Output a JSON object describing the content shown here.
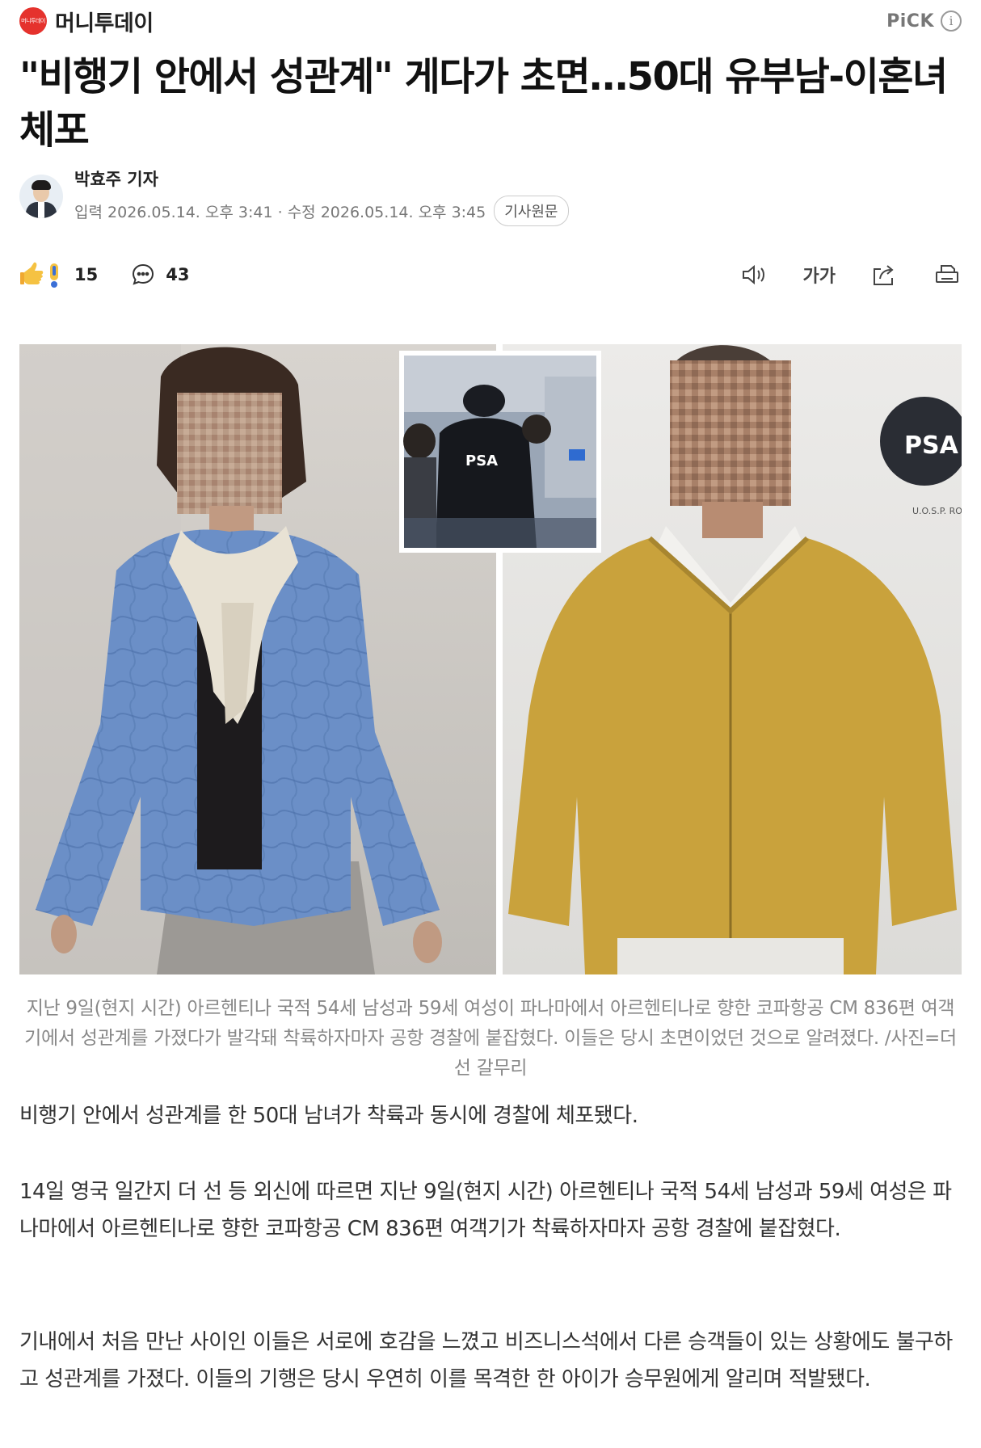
{
  "header": {
    "press_name": "머니투데이",
    "press_logo_text": "머니투데이",
    "pick_label": "PiCK",
    "info_icon": "info-icon"
  },
  "article": {
    "title": "\"비행기 안에서 성관계\" 게다가 초면…50대 유부남-이혼녀 체포",
    "reporter": "박효주 기자",
    "published_label": "입력",
    "published": "2026.05.14. 오후 3:41",
    "modified_label": "· 수정",
    "modified": "2026.05.14. 오후 3:45",
    "origin_button": "기사원문"
  },
  "actions": {
    "reaction_count": "15",
    "comment_count": "43",
    "font_label": "가가",
    "icons": [
      "reaction-icon",
      "comment-icon",
      "audio-icon",
      "font-size-icon",
      "share-icon",
      "print-icon"
    ]
  },
  "photo": {
    "inset_jacket_text": "PSA",
    "badge_text": "PSA",
    "wall_text": "U.O.S.P. RO"
  },
  "caption": "지난 9일(현지 시간) 아르헨티나 국적 54세 남성과 59세 여성이 파나마에서 아르헨티나로 향한 코파항공 CM 836편 여객기에서 성관계를 가졌다가 발각돼 착륙하자마자 공항 경찰에 붙잡혔다. 이들은 당시 초면이었던 것으로 알려졌다. /사진=더 선 갈무리",
  "body": [
    "비행기 안에서 성관계를 한 50대 남녀가 착륙과 동시에 경찰에 체포됐다.",
    "14일 영국 일간지 더 선 등 외신에 따르면 지난 9일(현지 시간) 아르헨티나 국적 54세 남성과 59세 여성은 파나마에서 아르헨티나로 향한 코파항공 CM 836편 여객기가 착륙하자마자 공항 경찰에 붙잡혔다.",
    "기내에서 처음 만난 사이인 이들은 서로에 호감을 느꼈고 비즈니스석에서 다른 승객들이 있는 상황에도 불구하고 성관계를 가졌다. 이들의 기행은 당시 우연히 이를 목격한 한 아이가 승무원에게 알리며 적발됐다."
  ]
}
